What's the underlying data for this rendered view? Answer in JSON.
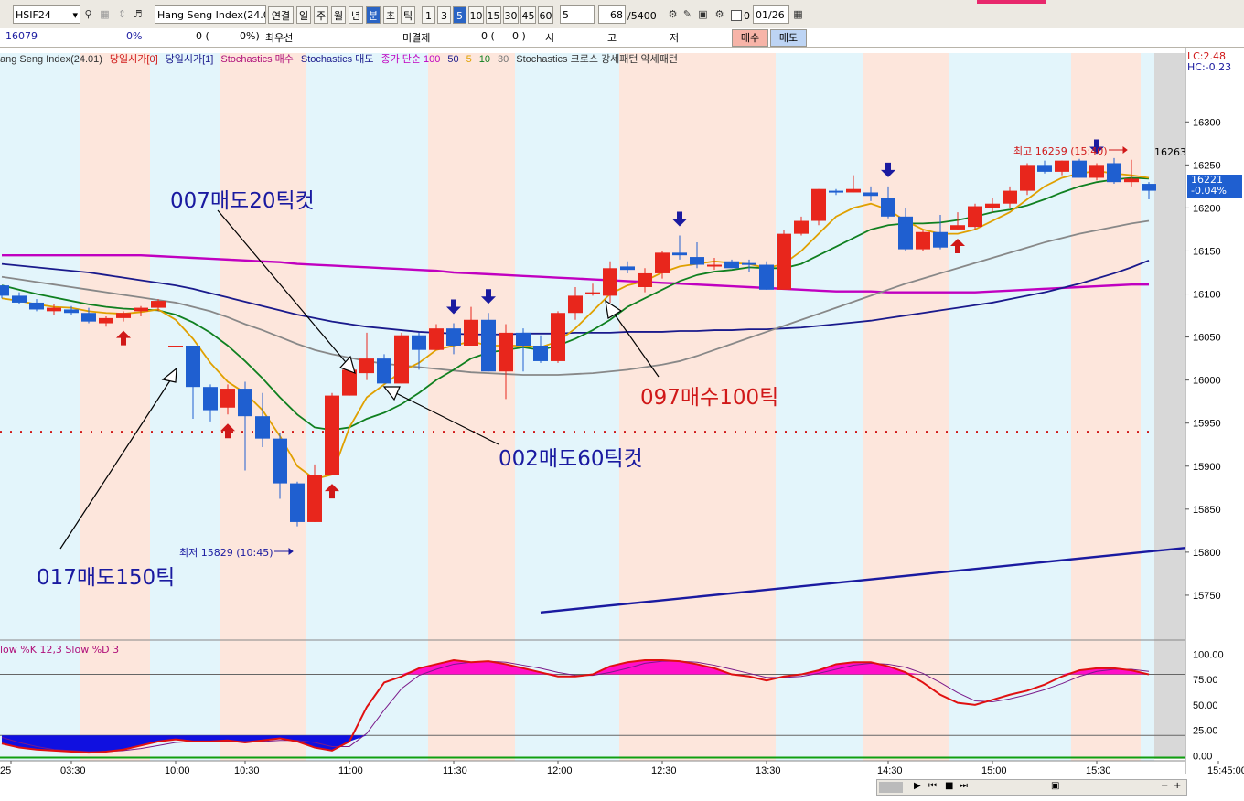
{
  "toolbar": {
    "code": "HSIF24",
    "index_name": "Hang Seng Index(24.0",
    "periods": [
      "연결",
      "일",
      "주",
      "월",
      "년",
      "분",
      "초",
      "틱"
    ],
    "minutes": [
      "1",
      "3",
      "5",
      "10",
      "15",
      "30",
      "45",
      "60"
    ],
    "interval": "5",
    "count": "68",
    "total": "/5400",
    "zero": "0",
    "date": "01/26"
  },
  "info_row": {
    "price": "16079",
    "pct": "0%",
    "qty": "0 (",
    "qty_pct": "0%)",
    "best": "최우선",
    "unfilled": "미결제",
    "unfilled_val": "0 (",
    "unfilled_pct": "0 )",
    "open_lbl": "시",
    "high_lbl": "고",
    "low_lbl": "저",
    "buy": "매수",
    "sell": "매도"
  },
  "legend": {
    "series": [
      {
        "text": "ang Seng Index(24.01)",
        "color": "#333333"
      },
      {
        "text": "당일시가[0]",
        "color": "#d01818"
      },
      {
        "text": "당일시가[1]",
        "color": "#1a1a8c"
      },
      {
        "text": "Stochastics 매수",
        "color": "#b0107a"
      },
      {
        "text": "Stochastics 매도",
        "color": "#1a1a8c"
      },
      {
        "text": "종가 단순 100",
        "color": "#c000c0"
      },
      {
        "text": "50",
        "color": "#1a1a8c"
      },
      {
        "text": "5",
        "color": "#e0a000"
      },
      {
        "text": "10",
        "color": "#108020"
      },
      {
        "text": "30",
        "color": "#777777"
      },
      {
        "text": "Stochastics 크로스 강세패턴  약세패턴",
        "color": "#333333"
      }
    ],
    "lc": "LC:2.48",
    "hc": "HC:-0.23",
    "stoch_title": "low %K 12,3  Slow %D 3"
  },
  "annotations": {
    "a1": "007매도20틱컷",
    "a2": "017매도150틱",
    "a3": "002매도60틱컷",
    "a4": "097매수100틱",
    "high": "최고 16259 (15:40)",
    "low": "최저 15829 (10:45)",
    "cur_price": "16221",
    "cur_pct": "-0.04%",
    "last_high": "16263"
  },
  "colors": {
    "up": "#e8261c",
    "down": "#1f5fd0",
    "accent": "#1a1aa0"
  },
  "chart_data": {
    "type": "candlestick",
    "xlim": [
      0,
      68
    ],
    "ylim": [
      15700,
      16380
    ],
    "y_ticks": [
      16300,
      16250,
      16200,
      16150,
      16100,
      16050,
      16000,
      15950,
      15900,
      15850,
      15800,
      15750
    ],
    "x_ticks": [
      {
        "i": 0,
        "label": "25"
      },
      {
        "i": 4,
        "label": "03:30"
      },
      {
        "i": 10,
        "label": "10:00"
      },
      {
        "i": 14,
        "label": "10:30"
      },
      {
        "i": 20,
        "label": "11:00"
      },
      {
        "i": 26,
        "label": "11:30"
      },
      {
        "i": 32,
        "label": "12:00"
      },
      {
        "i": 38,
        "label": "12:30"
      },
      {
        "i": 44,
        "label": "13:30"
      },
      {
        "i": 51,
        "label": "14:30"
      },
      {
        "i": 57,
        "label": "15:00"
      },
      {
        "i": 63,
        "label": "15:30"
      },
      {
        "i": 70,
        "label": "15:45:00"
      }
    ],
    "candles": [
      [
        16110,
        16110,
        16095,
        16098
      ],
      [
        16098,
        16102,
        16088,
        16090
      ],
      [
        16090,
        16094,
        16080,
        16082
      ],
      [
        16080,
        16088,
        16075,
        16084
      ],
      [
        16082,
        16086,
        16076,
        16078
      ],
      [
        16078,
        16084,
        16066,
        16068
      ],
      [
        16066,
        16074,
        16062,
        16072
      ],
      [
        16072,
        16080,
        16068,
        16078
      ],
      [
        16080,
        16086,
        16074,
        16084
      ],
      [
        16084,
        16094,
        16080,
        16092
      ],
      [
        16040,
        16040,
        16038,
        16040
      ],
      [
        16040,
        16040,
        15955,
        15992
      ],
      [
        15992,
        15995,
        15952,
        15965
      ],
      [
        15968,
        15995,
        15960,
        15990
      ],
      [
        15990,
        15998,
        15895,
        15958
      ],
      [
        15958,
        15985,
        15922,
        15932
      ],
      [
        15932,
        15938,
        15862,
        15880
      ],
      [
        15880,
        15882,
        15830,
        15835
      ],
      [
        15835,
        15902,
        15835,
        15890
      ],
      [
        15890,
        15985,
        15890,
        15982
      ],
      [
        15982,
        16018,
        15982,
        16012
      ],
      [
        16008,
        16055,
        16000,
        16025
      ],
      [
        16025,
        16030,
        15998,
        15996
      ],
      [
        15996,
        16055,
        15996,
        16052
      ],
      [
        16052,
        16055,
        16012,
        16035
      ],
      [
        16035,
        16065,
        16035,
        16060
      ],
      [
        16060,
        16066,
        16030,
        16040
      ],
      [
        16040,
        16085,
        16040,
        16070
      ],
      [
        16070,
        16078,
        16010,
        16010
      ],
      [
        16010,
        16065,
        15978,
        16055
      ],
      [
        16055,
        16060,
        16010,
        16040
      ],
      [
        16040,
        16052,
        16020,
        16022
      ],
      [
        16022,
        16080,
        16020,
        16078
      ],
      [
        16078,
        16108,
        16070,
        16098
      ],
      [
        16100,
        16112,
        16098,
        16102
      ],
      [
        16098,
        16138,
        16090,
        16130
      ],
      [
        16132,
        16138,
        16124,
        16128
      ],
      [
        16108,
        16130,
        16102,
        16124
      ],
      [
        16124,
        16150,
        16118,
        16148
      ],
      [
        16148,
        16168,
        16140,
        16145
      ],
      [
        16143,
        16160,
        16130,
        16134
      ],
      [
        16134,
        16142,
        16128,
        16134
      ],
      [
        16138,
        16140,
        16130,
        16130
      ],
      [
        16136,
        16140,
        16126,
        16134
      ],
      [
        16134,
        16138,
        16105,
        16105
      ],
      [
        16105,
        16175,
        16105,
        16170
      ],
      [
        16170,
        16190,
        16168,
        16185
      ],
      [
        16185,
        16222,
        16180,
        16222
      ],
      [
        16220,
        16222,
        16215,
        16218
      ],
      [
        16218,
        16238,
        16218,
        16222
      ],
      [
        16218,
        16225,
        16208,
        16214
      ],
      [
        16212,
        16225,
        16188,
        16190
      ],
      [
        16190,
        16200,
        16150,
        16152
      ],
      [
        16152,
        16175,
        16150,
        16172
      ],
      [
        16172,
        16192,
        16152,
        16154
      ],
      [
        16175,
        16195,
        16175,
        16180
      ],
      [
        16178,
        16205,
        16175,
        16202
      ],
      [
        16200,
        16212,
        16195,
        16205
      ],
      [
        16205,
        16225,
        16200,
        16220
      ],
      [
        16220,
        16252,
        16215,
        16250
      ],
      [
        16250,
        16255,
        16240,
        16242
      ],
      [
        16242,
        16255,
        16238,
        16255
      ],
      [
        16255,
        16257,
        16235,
        16235
      ],
      [
        16235,
        16252,
        16232,
        16250
      ],
      [
        16252,
        16258,
        16228,
        16230
      ],
      [
        16230,
        16256,
        16225,
        16234
      ],
      [
        16228,
        16230,
        16210,
        16220
      ]
    ],
    "ma5": [
      16095,
      16092,
      16088,
      16085,
      16084,
      16080,
      16078,
      16077,
      16079,
      16082,
      16070,
      16048,
      16020,
      15998,
      15985,
      15965,
      15935,
      15900,
      15885,
      15890,
      15945,
      15980,
      15995,
      16010,
      16020,
      16035,
      16040,
      16045,
      16040,
      16040,
      16040,
      16038,
      16045,
      16060,
      16080,
      16100,
      16110,
      16115,
      16125,
      16132,
      16135,
      16138,
      16136,
      16135,
      16130,
      16135,
      16150,
      16170,
      16190,
      16200,
      16205,
      16198,
      16185,
      16175,
      16170,
      16170,
      16175,
      16185,
      16195,
      16210,
      16225,
      16235,
      16240,
      16243,
      16240,
      16238,
      16235
    ],
    "ma10": [
      16110,
      16105,
      16100,
      16096,
      16092,
      16088,
      16085,
      16083,
      16082,
      16081,
      16076,
      16067,
      16055,
      16040,
      16022,
      16002,
      15980,
      15960,
      15945,
      15942,
      15945,
      15955,
      15962,
      15972,
      15985,
      16000,
      16012,
      16025,
      16032,
      16035,
      16038,
      16035,
      16040,
      16048,
      16058,
      16070,
      16085,
      16095,
      16105,
      16115,
      16122,
      16126,
      16128,
      16131,
      16130,
      16130,
      16135,
      16145,
      16155,
      16165,
      16175,
      16180,
      16182,
      16182,
      16183,
      16186,
      16190,
      16195,
      16198,
      16203,
      16210,
      16218,
      16225,
      16230,
      16233,
      16235,
      16234
    ],
    "ma30": [
      16120,
      16117,
      16114,
      16111,
      16108,
      16105,
      16102,
      16099,
      16096,
      16093,
      16090,
      16085,
      16080,
      16073,
      16065,
      16058,
      16050,
      16042,
      16035,
      16030,
      16026,
      16022,
      16019,
      16017,
      16015,
      16013,
      16011,
      16009,
      16008,
      16007,
      16006,
      16006,
      16006,
      16007,
      16008,
      16010,
      16012,
      16015,
      16018,
      16022,
      16028,
      16035,
      16042,
      16049,
      16056,
      16063,
      16070,
      16077,
      16084,
      16091,
      16098,
      16105,
      16112,
      16118,
      16124,
      16130,
      16136,
      16142,
      16148,
      16154,
      16160,
      16165,
      16170,
      16174,
      16178,
      16182,
      16185
    ],
    "ma50": [
      16135,
      16133,
      16131,
      16129,
      16127,
      16125,
      16122,
      16119,
      16116,
      16113,
      16110,
      16106,
      16101,
      16096,
      16091,
      16086,
      16081,
      16076,
      16072,
      16068,
      16065,
      16062,
      16060,
      16058,
      16056,
      16055,
      16054,
      16053,
      16053,
      16053,
      16054,
      16054,
      16054,
      16055,
      16055,
      16055,
      16056,
      16056,
      16056,
      16057,
      16057,
      16058,
      16058,
      16059,
      16059,
      16060,
      16061,
      16063,
      16065,
      16067,
      16069,
      16072,
      16075,
      16078,
      16081,
      16084,
      16087,
      16090,
      16094,
      16098,
      16102,
      16107,
      16112,
      16118,
      16124,
      16131,
      16139
    ],
    "ma100": [
      16145,
      16145,
      16145,
      16145,
      16145,
      16145,
      16145,
      16145,
      16145,
      16144,
      16143,
      16142,
      16141,
      16140,
      16139,
      16138,
      16137,
      16135,
      16134,
      16133,
      16132,
      16131,
      16130,
      16129,
      16128,
      16127,
      16125,
      16124,
      16123,
      16122,
      16121,
      16120,
      16119,
      16118,
      16117,
      16116,
      16115,
      16114,
      16113,
      16112,
      16111,
      16110,
      16109,
      16108,
      16107,
      16106,
      16105,
      16104,
      16103,
      16103,
      16103,
      16102,
      16102,
      16102,
      16102,
      16102,
      16102,
      16103,
      16104,
      16105,
      16106,
      16107,
      16108,
      16109,
      16110,
      16111,
      16111
    ],
    "trendline": [
      [
        31,
        15730
      ],
      [
        68,
        15805
      ]
    ],
    "support": 15940,
    "buy_signals": [
      7,
      13,
      19,
      55
    ],
    "sell_signals": [
      26,
      28,
      39,
      51,
      63
    ],
    "stoch_ylim": [
      -5,
      112
    ],
    "stoch_ticks": [
      100,
      75,
      50,
      25,
      0
    ],
    "stoch_k": [
      12,
      8,
      6,
      5,
      4,
      3,
      4,
      6,
      10,
      14,
      16,
      14,
      14,
      15,
      13,
      15,
      17,
      14,
      8,
      5,
      14,
      48,
      72,
      78,
      86,
      90,
      94,
      92,
      93,
      90,
      86,
      82,
      78,
      78,
      80,
      88,
      92,
      94,
      94,
      93,
      90,
      86,
      80,
      78,
      74,
      78,
      80,
      84,
      90,
      92,
      92,
      88,
      82,
      72,
      60,
      52,
      50,
      55,
      60,
      64,
      70,
      78,
      84,
      86,
      86,
      84,
      80
    ],
    "stoch_d": [
      18,
      13,
      9,
      6,
      5,
      4,
      4,
      5,
      7,
      10,
      13,
      14,
      14,
      14,
      14,
      14,
      15,
      15,
      13,
      9,
      9,
      22,
      45,
      66,
      79,
      85,
      90,
      92,
      93,
      92,
      89,
      86,
      82,
      79,
      79,
      82,
      86,
      91,
      93,
      93,
      92,
      89,
      85,
      81,
      77,
      77,
      78,
      81,
      85,
      89,
      91,
      90,
      87,
      81,
      72,
      62,
      54,
      53,
      56,
      60,
      65,
      71,
      78,
      83,
      85,
      85,
      83
    ]
  }
}
